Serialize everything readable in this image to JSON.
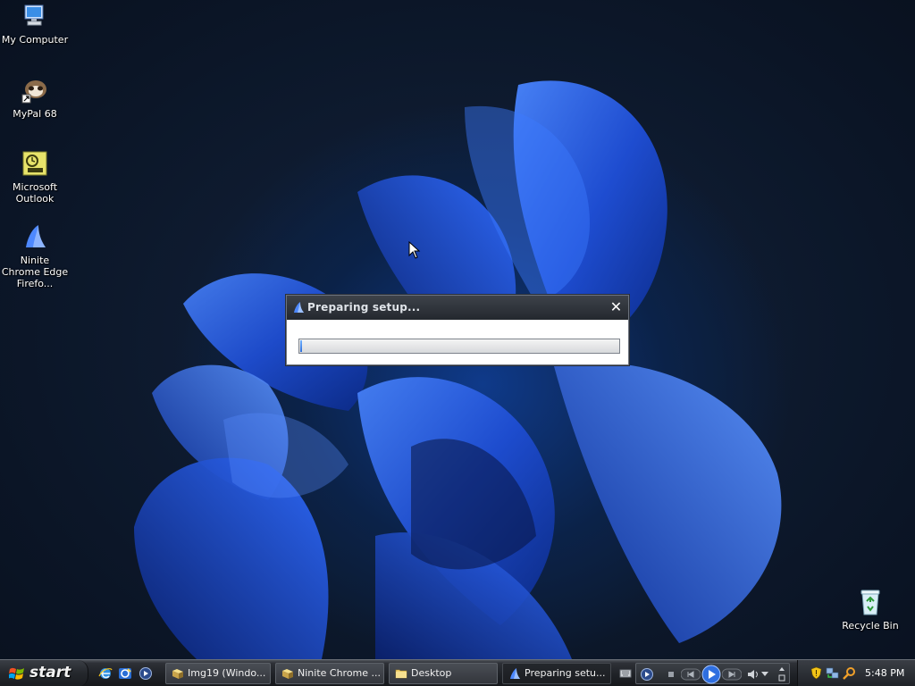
{
  "desktop": {
    "icons": [
      {
        "label": "My Computer",
        "icon": "computer-icon"
      },
      {
        "label": "MyPal 68",
        "icon": "mypal-icon"
      },
      {
        "label": "Microsoft Outlook",
        "icon": "outlook-icon"
      },
      {
        "label": "Ninite Chrome Edge Firefo...",
        "icon": "ninite-icon"
      },
      {
        "label": "Recycle Bin",
        "icon": "recycle-bin-icon"
      }
    ]
  },
  "dialog": {
    "title": "Preparing setup...",
    "close_glyph": "✕",
    "progress_fraction": 0.005
  },
  "taskbar": {
    "start_label": "start",
    "quick_launch": [
      "internet-explorer-icon",
      "outlook-express-icon",
      "media-player-icon"
    ],
    "buttons": [
      {
        "label": "Img19 (Windo...",
        "icon": "app-icon",
        "active": false
      },
      {
        "label": "Ninite Chrome ...",
        "icon": "ninite-icon",
        "active": false
      },
      {
        "label": "Desktop",
        "icon": "folder-icon",
        "active": false
      },
      {
        "label": "Preparing setu...",
        "icon": "ninite-icon",
        "active": true
      }
    ],
    "clock": "5:48 PM"
  },
  "colors": {
    "accent_blue": "#2a5fe0",
    "taskbar_dark": "#1e2126",
    "dialog_title": "#2e3238"
  }
}
